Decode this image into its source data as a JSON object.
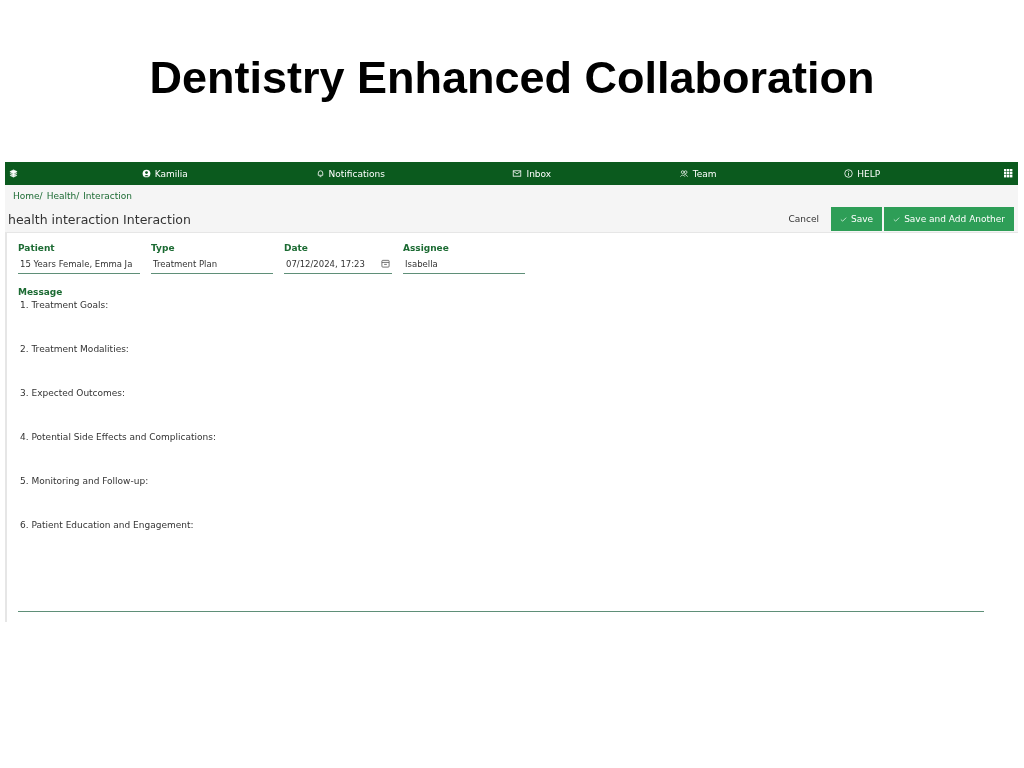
{
  "page_title": "Dentistry Enhanced Collaboration",
  "nav": {
    "items": [
      {
        "kind": "user",
        "label": "Kamilia"
      },
      {
        "kind": "bell",
        "label": "Notifications"
      },
      {
        "kind": "mail",
        "label": "Inbox"
      },
      {
        "kind": "team",
        "label": "Team"
      },
      {
        "kind": "info",
        "label": "HELP"
      }
    ]
  },
  "breadcrumb": [
    "Home/",
    "Health/",
    "Interaction"
  ],
  "header": {
    "title": "health interaction Interaction",
    "cancel": "Cancel",
    "save": "Save",
    "save_add": "Save and Add Another"
  },
  "fields": [
    {
      "kind": "text",
      "label": "Patient",
      "value": "15 Years Female, Emma Ja"
    },
    {
      "kind": "text",
      "label": "Type",
      "value": "Treatment Plan"
    },
    {
      "kind": "date",
      "label": "Date",
      "value": "07/12/2024, 17:23"
    },
    {
      "kind": "text",
      "label": "Assignee",
      "value": "Isabella"
    }
  ],
  "message": {
    "label": "Message",
    "lines": [
      "1. Treatment Goals:",
      "2. Treatment Modalities:",
      "3. Expected Outcomes:",
      "4. Potential Side Effects and Complications:",
      "5. Monitoring and Follow-up:",
      "6. Patient Education and Engagement:"
    ]
  }
}
